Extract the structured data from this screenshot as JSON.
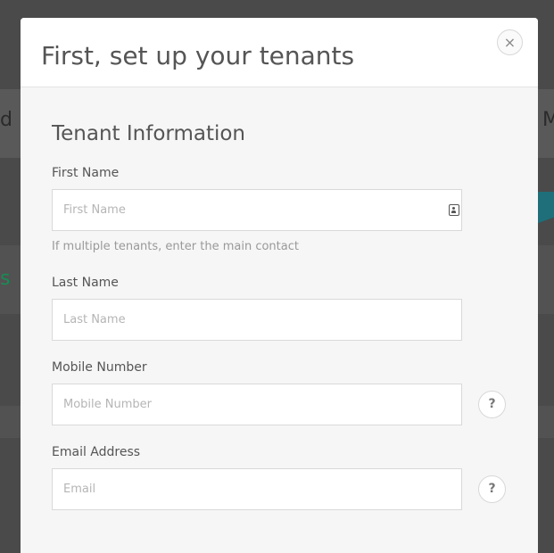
{
  "background": {
    "left_fragment": "d",
    "right_fragment": "M",
    "green_fragment": "s"
  },
  "modal": {
    "title": "First, set up your tenants",
    "close_symbol": "×"
  },
  "tenant_info": {
    "section_title": "Tenant Information",
    "first_name": {
      "label": "First Name",
      "placeholder": "First Name",
      "value": "",
      "help_text": "If multiple tenants, enter the main contact"
    },
    "last_name": {
      "label": "Last Name",
      "placeholder": "Last Name",
      "value": ""
    },
    "mobile_number": {
      "label": "Mobile Number",
      "placeholder": "Mobile Number",
      "value": "",
      "help_symbol": "?"
    },
    "email": {
      "label": "Email Address",
      "placeholder": "Email",
      "value": "",
      "help_symbol": "?"
    }
  },
  "icons": {
    "close": "close-icon",
    "contact_card": "contact-card-icon",
    "help": "question-mark-icon"
  },
  "colors": {
    "overlay": "#4a4a4a",
    "modal_body": "#f6f6f6",
    "accent_teal": "#1f6f7a",
    "accent_green": "#1a8a55"
  }
}
